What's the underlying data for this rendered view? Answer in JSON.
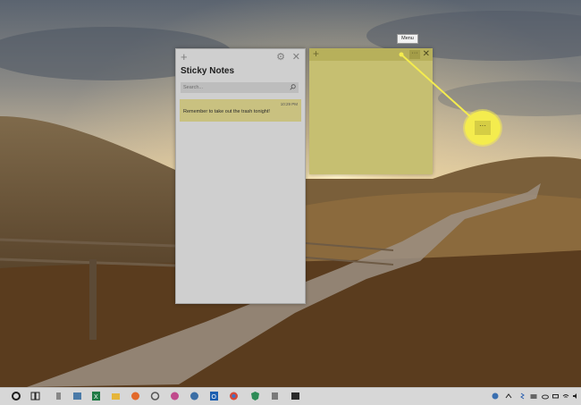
{
  "list_window": {
    "title": "Sticky Notes",
    "add_icon": "+",
    "gear_icon": "⚙",
    "close_icon": "✕",
    "search_placeholder": "Search...",
    "notes": [
      {
        "time": "10:29 PM",
        "text": "Remember to take out the trash tonight!"
      }
    ]
  },
  "note_window": {
    "add_icon": "+",
    "menu_icon": "···",
    "close_icon": "✕"
  },
  "tooltip": {
    "label": "Menu"
  },
  "callout": {
    "menu_icon": "···"
  },
  "colors": {
    "note_yellow": "#c6bf71",
    "note_header": "#b7b05b",
    "callout_yellow": "#f4ec4e",
    "list_bg": "#cfcfcf"
  },
  "taskbar": {
    "icons": [
      "start-icon",
      "task-view-icon",
      "sticky-notes-icon",
      "photos-icon",
      "excel-icon",
      "file-explorer-icon",
      "firefox-icon",
      "settings-icon",
      "paint-icon",
      "edge-icon",
      "outlook-icon",
      "chrome-icon",
      "defender-icon",
      "snipping-icon",
      "terminal-icon"
    ],
    "tray_icons": [
      "network-icon",
      "chevron-up-icon",
      "bluetooth-icon",
      "folder-icon",
      "onedrive-icon",
      "battery-icon",
      "wifi-icon",
      "volume-icon"
    ]
  }
}
